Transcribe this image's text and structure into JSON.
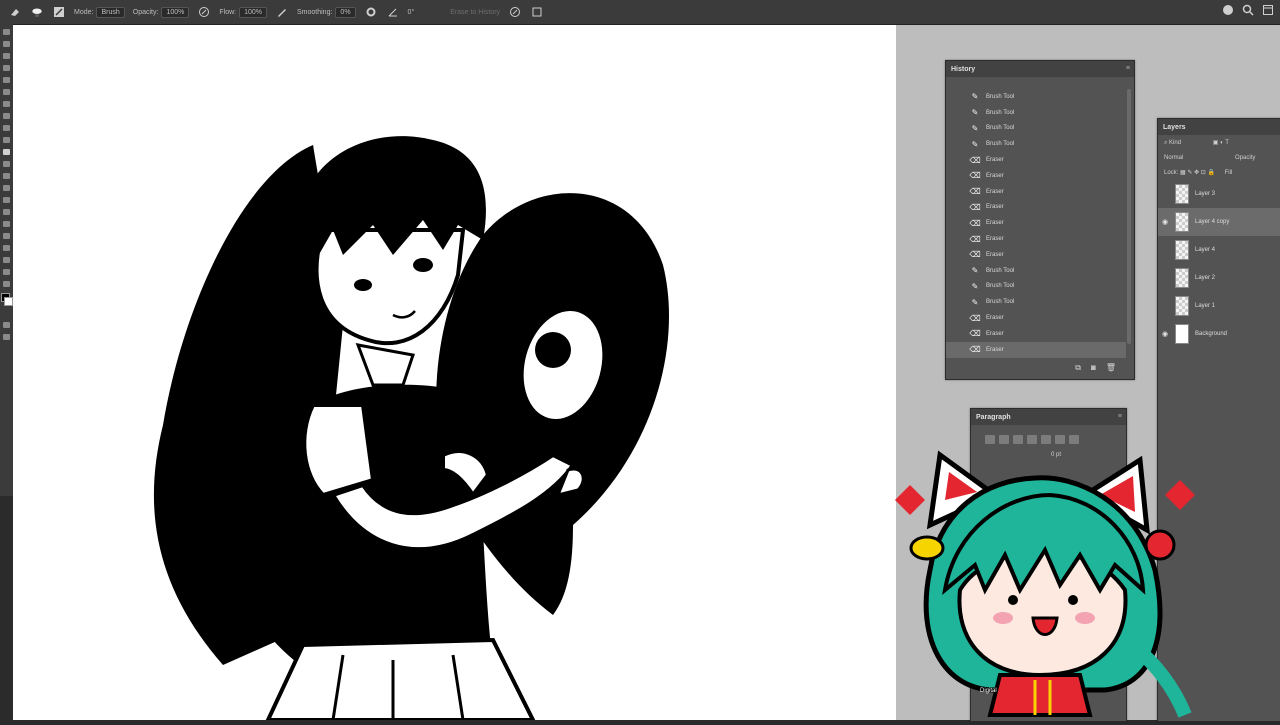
{
  "options_bar": {
    "mode_label": "Mode:",
    "mode_value": "Brush",
    "opacity_label": "Opacity:",
    "opacity_value": "100%",
    "flow_label": "Flow:",
    "flow_value": "100%",
    "smoothing_label": "Smoothing:",
    "smoothing_value": "0%",
    "angle_value": "0°",
    "erase_history_label": "Erase to History"
  },
  "history": {
    "title": "History",
    "items": [
      {
        "label": "Brush Tool",
        "icon": "brush-icon"
      },
      {
        "label": "Brush Tool",
        "icon": "brush-icon"
      },
      {
        "label": "Brush Tool",
        "icon": "brush-icon"
      },
      {
        "label": "Brush Tool",
        "icon": "brush-icon"
      },
      {
        "label": "Eraser",
        "icon": "eraser-icon"
      },
      {
        "label": "Eraser",
        "icon": "eraser-icon"
      },
      {
        "label": "Eraser",
        "icon": "eraser-icon"
      },
      {
        "label": "Eraser",
        "icon": "eraser-icon"
      },
      {
        "label": "Eraser",
        "icon": "eraser-icon"
      },
      {
        "label": "Eraser",
        "icon": "eraser-icon"
      },
      {
        "label": "Eraser",
        "icon": "eraser-icon"
      },
      {
        "label": "Brush Tool",
        "icon": "brush-icon"
      },
      {
        "label": "Brush Tool",
        "icon": "brush-icon"
      },
      {
        "label": "Brush Tool",
        "icon": "brush-icon"
      },
      {
        "label": "Eraser",
        "icon": "eraser-icon"
      },
      {
        "label": "Eraser",
        "icon": "eraser-icon"
      },
      {
        "label": "Eraser",
        "icon": "eraser-icon"
      }
    ]
  },
  "layers": {
    "title": "Layers",
    "kind_label": "Kind",
    "blend_mode": "Normal",
    "opacity_label": "Opacity",
    "lock_label": "Lock:",
    "fill_label": "Fill",
    "items": [
      {
        "name": "Layer 3",
        "visible": false,
        "selected": false
      },
      {
        "name": "Layer 4 copy",
        "visible": true,
        "selected": true
      },
      {
        "name": "Layer 4",
        "visible": false,
        "selected": false
      },
      {
        "name": "Layer 2",
        "visible": false,
        "selected": false
      },
      {
        "name": "Layer 1",
        "visible": false,
        "selected": false
      },
      {
        "name": "Background",
        "visible": true,
        "selected": false
      }
    ]
  },
  "paragraph": {
    "title": "Paragraph",
    "indent_value": "0 pt"
  },
  "sticker": {
    "bottom_text": "Digital"
  },
  "colors": {
    "ui_dark": "#3b3b3b",
    "panel": "#535353",
    "canvas": "#ffffff",
    "sticker_hair": "#1fb59a",
    "sticker_red": "#e3262f",
    "sticker_yellow": "#f5d400"
  }
}
